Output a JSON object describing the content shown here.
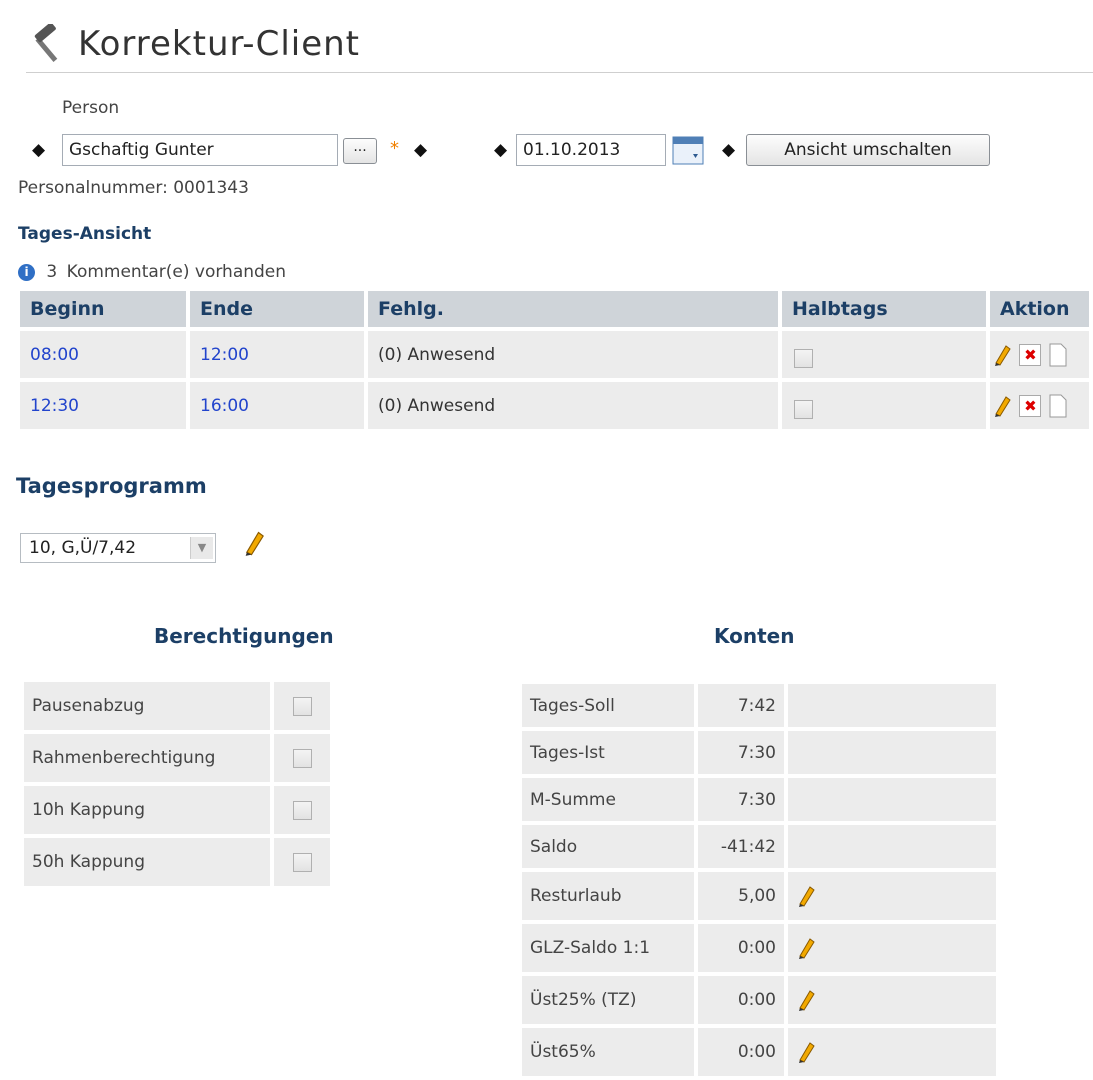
{
  "header": {
    "title": "Korrektur-Client",
    "icon": "hammer-icon"
  },
  "person": {
    "label": "Person",
    "name_value": "Gschaftig Gunter",
    "browse_label": "...",
    "required_mark": "*",
    "date_value": "01.10.2013",
    "toggle_view_label": "Ansicht umschalten",
    "personnel_number": "Personalnummer: 0001343"
  },
  "day_view": {
    "heading": "Tages-Ansicht",
    "comments_count": "3",
    "comments_text": "Kommentar(e) vorhanden",
    "columns": [
      "Beginn",
      "Ende",
      "Fehlg.",
      "Halbtags",
      "Aktion"
    ],
    "rows": [
      {
        "begin": "08:00",
        "end": "12:00",
        "absence": "(0) Anwesend"
      },
      {
        "begin": "12:30",
        "end": "16:00",
        "absence": "(0) Anwesend"
      }
    ]
  },
  "day_program": {
    "heading": "Tagesprogramm",
    "selected": "10, G,Ü/7,42"
  },
  "permissions": {
    "heading": "Berechtigungen",
    "items": [
      "Pausenabzug",
      "Rahmenberechtigung",
      "10h Kappung",
      "50h Kappung"
    ]
  },
  "accounts": {
    "heading": "Konten",
    "rows": [
      {
        "label": "Tages-Soll",
        "value": "7:42"
      },
      {
        "label": "Tages-Ist",
        "value": "7:30"
      },
      {
        "label": "M-Summe",
        "value": "7:30"
      },
      {
        "label": "Saldo",
        "value": "-41:42"
      },
      {
        "label": "Resturlaub",
        "value": "5,00"
      },
      {
        "label": "GLZ-Saldo 1:1",
        "value": "0:00"
      },
      {
        "label": "Üst25% (TZ)",
        "value": "0:00"
      },
      {
        "label": "Üst65%",
        "value": "0:00"
      }
    ]
  },
  "colors": {
    "heading": "#1c3f66",
    "time_link": "#2244cc",
    "required": "#f08000"
  }
}
